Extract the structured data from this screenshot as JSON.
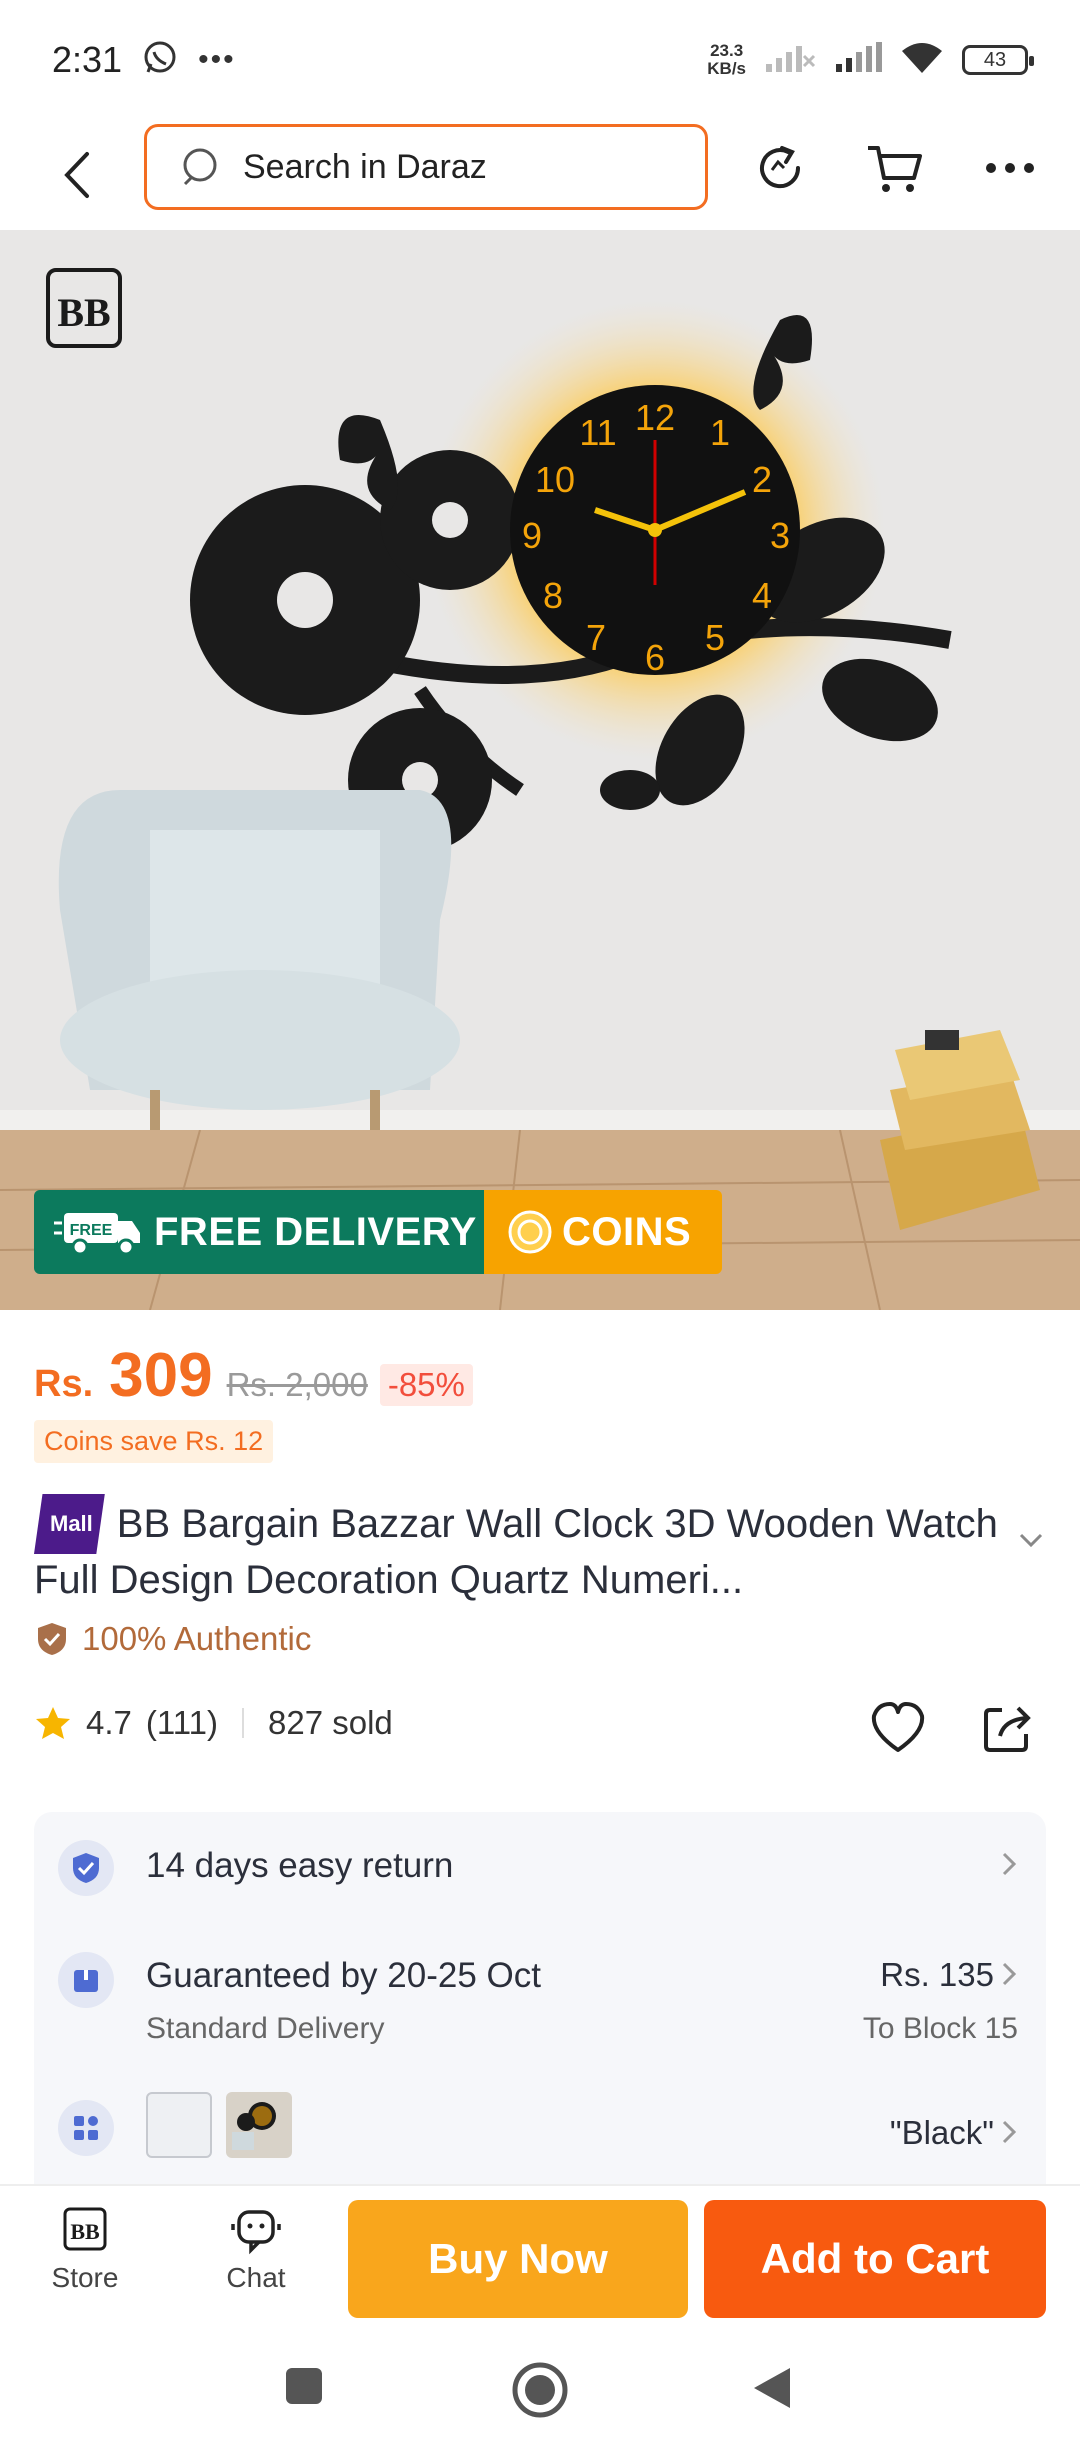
{
  "status_bar": {
    "time": "2:31",
    "speed_value": "23.3",
    "speed_unit": "KB/s",
    "battery": "43"
  },
  "header": {
    "search_placeholder": "Search in Daraz"
  },
  "hero": {
    "promo_free_label": "FREE DELIVERY",
    "promo_free_truck_text": "FREE",
    "promo_coins_label": "COINS"
  },
  "price": {
    "currency": "Rs.",
    "current": "309",
    "original": "Rs. 2,000",
    "discount": "-85%",
    "coins_save": "Coins save Rs. 12"
  },
  "product": {
    "mall_badge": "Mall",
    "title": "BB Bargain Bazzar Wall Clock 3D Wooden Watch Full Design Decoration Quartz Numeri...",
    "authentic": "100% Authentic",
    "rating": "4.7",
    "rating_count": "(111)",
    "sold": "827 sold"
  },
  "info": {
    "return": "14 days easy return",
    "delivery_main": "Guaranteed by 20-25 Oct",
    "delivery_sub": "Standard Delivery",
    "delivery_price": "Rs. 135",
    "delivery_location": "To Block 15",
    "variant_selected": "\"Black\""
  },
  "bottom_bar": {
    "store_label": "Store",
    "chat_label": "Chat",
    "buy_now": "Buy Now",
    "add_to_cart": "Add to Cart"
  },
  "colors": {
    "accent_orange": "#f36d21",
    "promo_green": "#0c7a5d",
    "promo_yellow": "#f7a300",
    "buy_now": "#f9a61c",
    "add_to_cart": "#f85a0f"
  }
}
